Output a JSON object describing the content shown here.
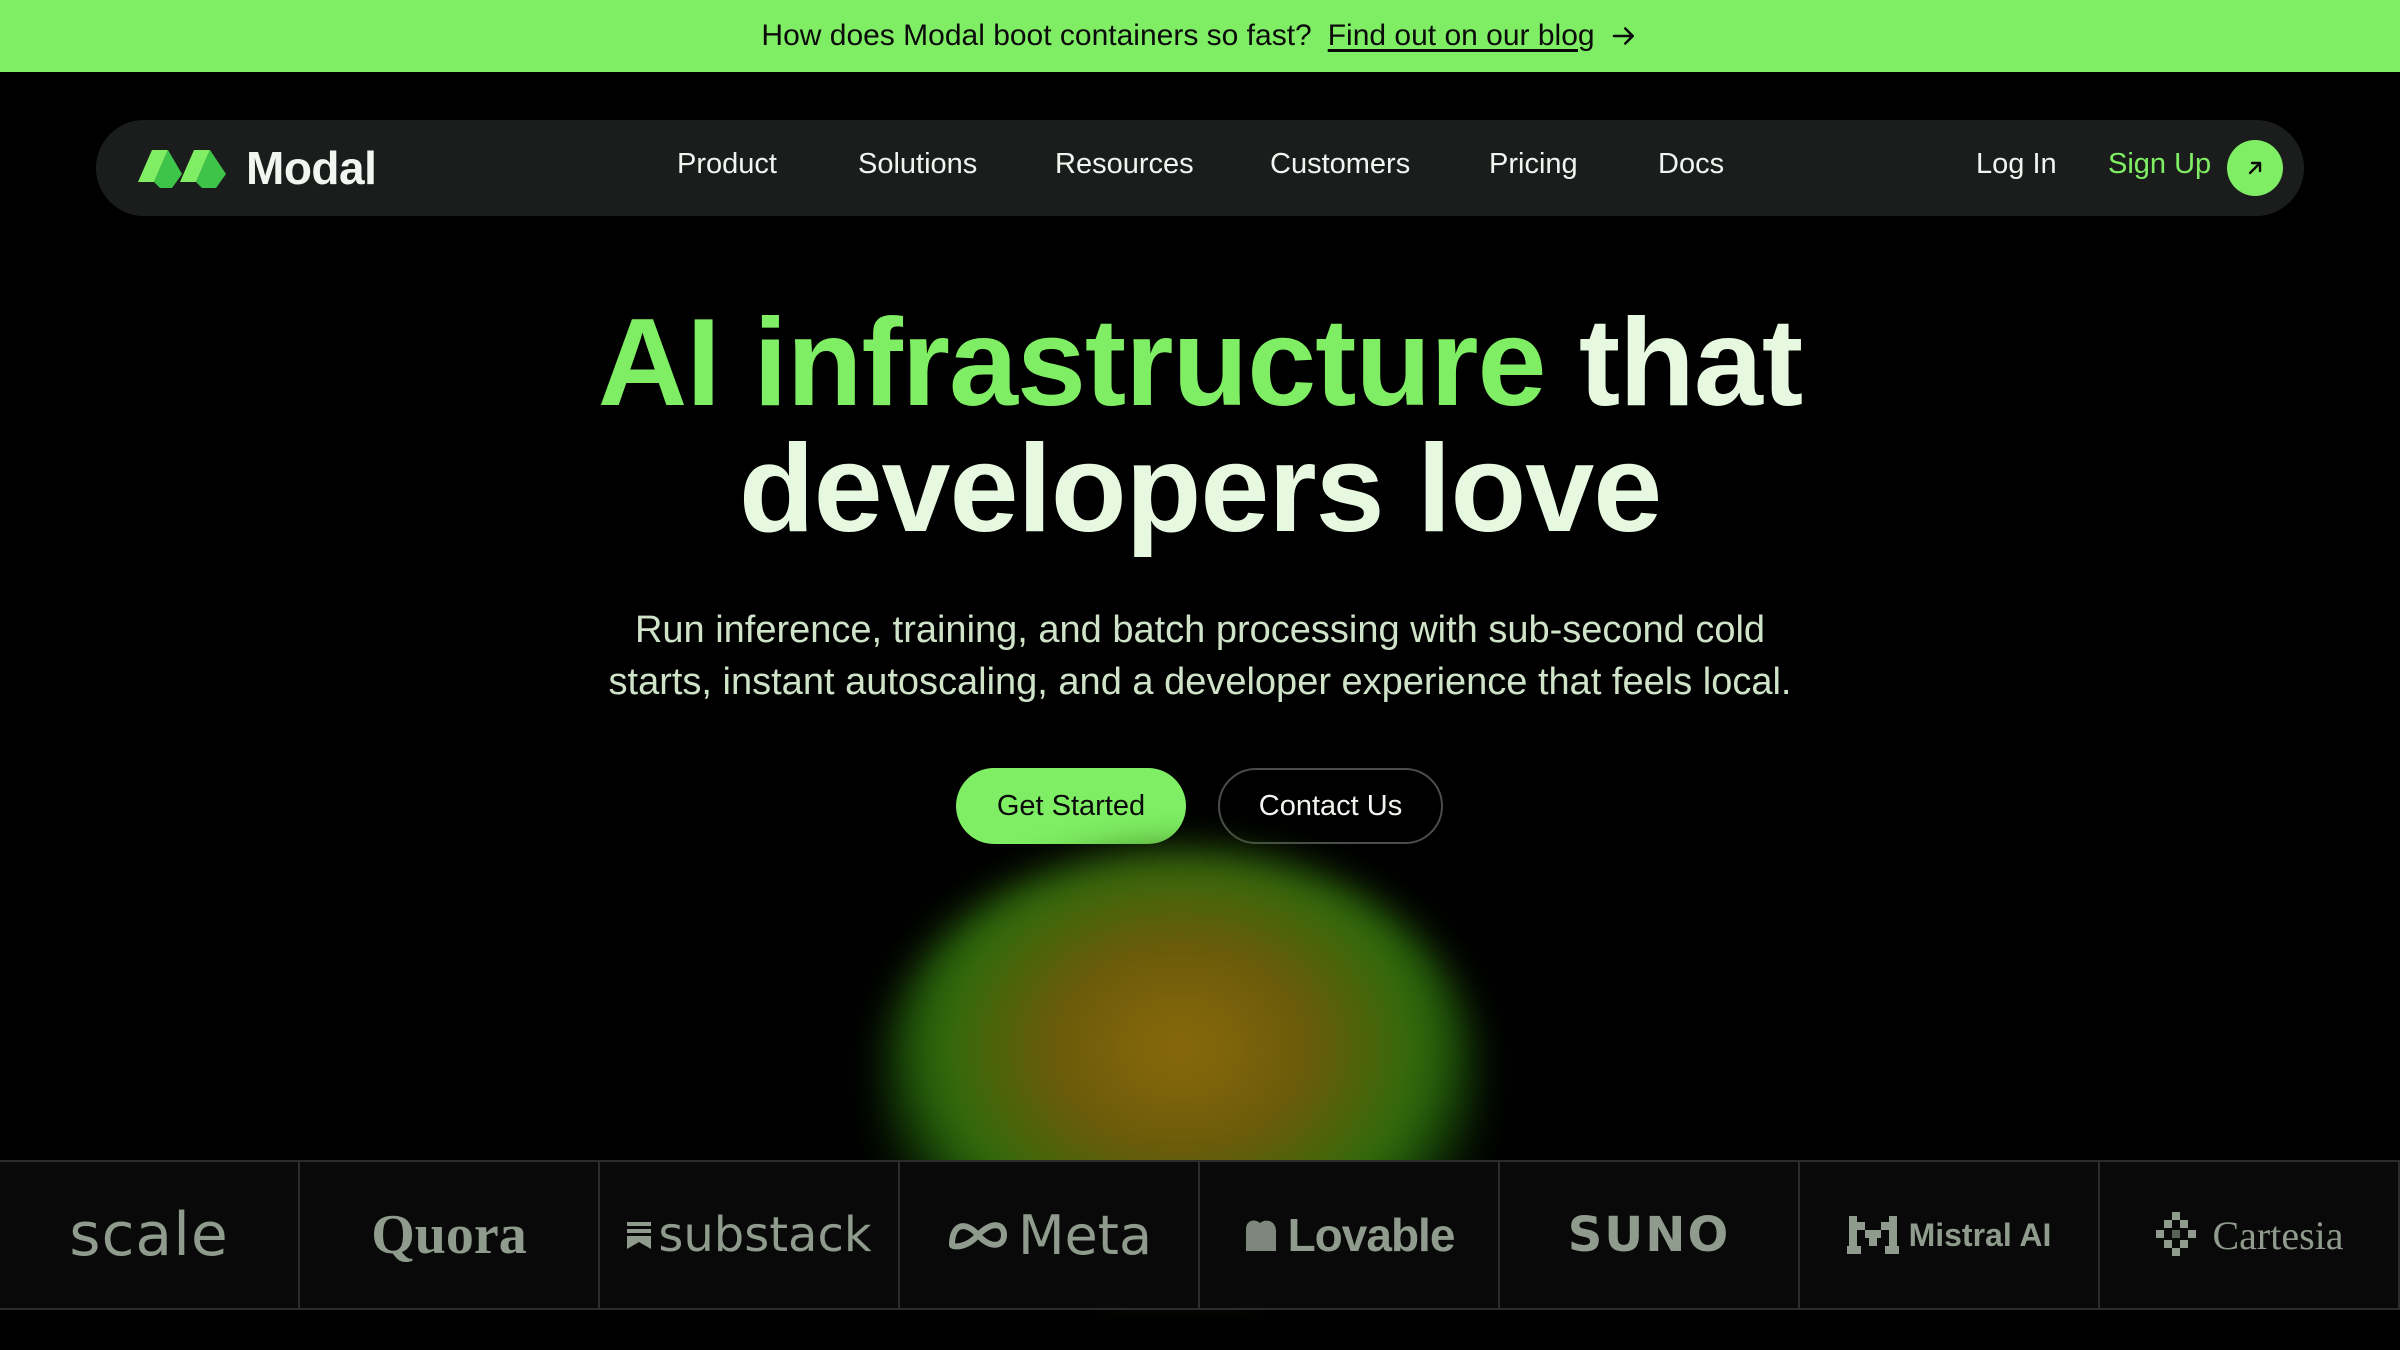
{
  "banner": {
    "question": "How does Modal boot containers so fast?",
    "link_label": "Find out on our blog"
  },
  "nav": {
    "brand": "Modal",
    "items": [
      {
        "label": "Product"
      },
      {
        "label": "Solutions"
      },
      {
        "label": "Resources"
      },
      {
        "label": "Customers"
      },
      {
        "label": "Pricing"
      },
      {
        "label": "Docs"
      }
    ],
    "login_label": "Log In",
    "signup_label": "Sign Up"
  },
  "hero": {
    "headline_accent": "AI infrastructure",
    "headline_rest": " that",
    "headline_line2": "developers love",
    "subtext_line1": "Run inference, training, and batch processing with sub-second cold",
    "subtext_line2": "starts, instant autoscaling, and a developer experience that feels local.",
    "primary_cta": "Get Started",
    "secondary_cta": "Contact Us"
  },
  "customers": [
    {
      "name": "scale",
      "icon": ""
    },
    {
      "name": "Quora",
      "icon": ""
    },
    {
      "name": "substack",
      "icon": "substack-icon"
    },
    {
      "name": "Meta",
      "icon": "meta-infinity-icon"
    },
    {
      "name": "Lovable",
      "icon": "lovable-heart-icon"
    },
    {
      "name": "SUNO",
      "icon": ""
    },
    {
      "name": "Mistral AI",
      "icon": "mistral-m-icon"
    },
    {
      "name": "Cartesia",
      "icon": "cartesia-pixel-icon"
    }
  ],
  "colors": {
    "accent": "#7fee64",
    "background": "#000000",
    "nav_background": "#1b1d1c",
    "headline_text": "#e7f8e0"
  }
}
